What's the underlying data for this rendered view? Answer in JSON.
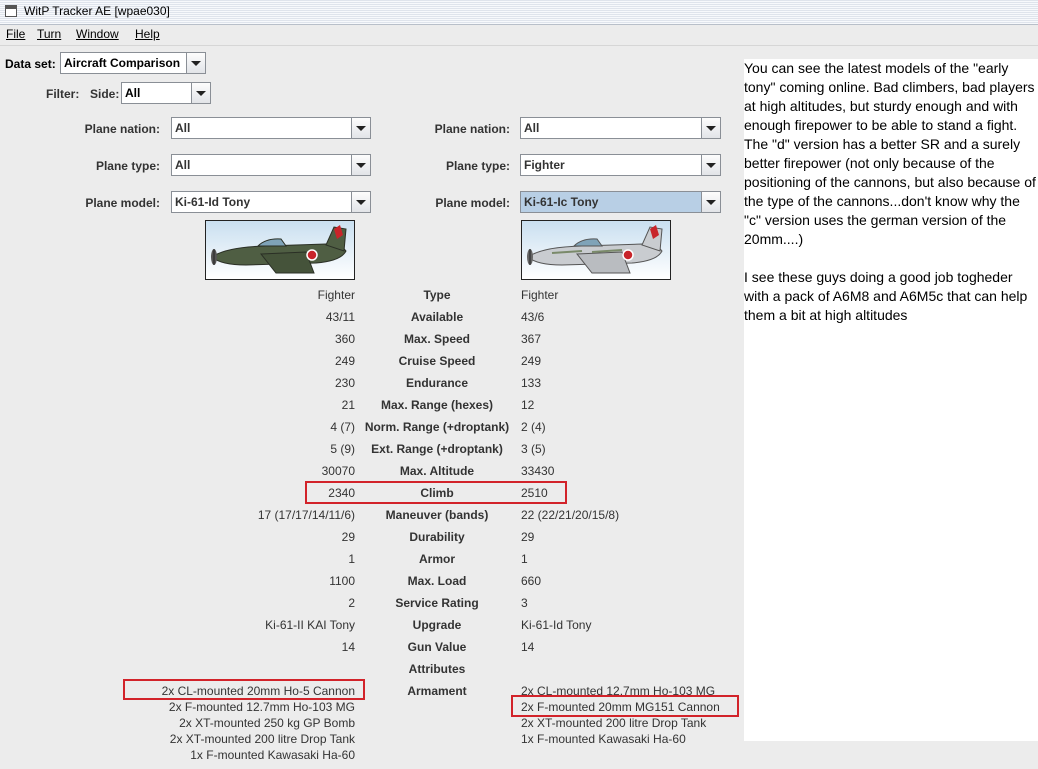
{
  "window": {
    "title": "WitP Tracker AE [wpae030]"
  },
  "menu": [
    "File",
    "Turn",
    "Window",
    "Help"
  ],
  "dataset": {
    "label": "Data set:",
    "value": "Aircraft Comparison"
  },
  "filter": {
    "label": "Filter:",
    "side_label": "Side:",
    "side_value": "All"
  },
  "left": {
    "nation_label": "Plane nation:",
    "nation": "All",
    "type_label": "Plane type:",
    "type": "All",
    "model_label": "Plane model:",
    "model": "Ki-61-Id Tony"
  },
  "right": {
    "nation_label": "Plane nation:",
    "nation": "All",
    "type_label": "Plane type:",
    "type": "Fighter",
    "model_label": "Plane model:",
    "model": "Ki-61-Ic Tony"
  },
  "stats": [
    {
      "label": "Type",
      "left": "Fighter",
      "right": "Fighter"
    },
    {
      "label": "Available",
      "left": "43/11",
      "right": "43/6"
    },
    {
      "label": "Max. Speed",
      "left": "360",
      "right": "367"
    },
    {
      "label": "Cruise Speed",
      "left": "249",
      "right": "249"
    },
    {
      "label": "Endurance",
      "left": "230",
      "right": "133"
    },
    {
      "label": "Max. Range (hexes)",
      "left": "21",
      "right": "12"
    },
    {
      "label": "Norm. Range (+droptank)",
      "left": "4 (7)",
      "right": "2 (4)"
    },
    {
      "label": "Ext. Range (+droptank)",
      "left": "5 (9)",
      "right": "3 (5)"
    },
    {
      "label": "Max. Altitude",
      "left": "30070",
      "right": "33430"
    },
    {
      "label": "Climb",
      "left": "2340",
      "right": "2510"
    },
    {
      "label": "Maneuver (bands)",
      "left": "17 (17/17/14/11/6)",
      "right": "22 (22/21/20/15/8)"
    },
    {
      "label": "Durability",
      "left": "29",
      "right": "29"
    },
    {
      "label": "Armor",
      "left": "1",
      "right": "1"
    },
    {
      "label": "Max. Load",
      "left": "1100",
      "right": "660"
    },
    {
      "label": "Service Rating",
      "left": "2",
      "right": "3"
    },
    {
      "label": "Upgrade",
      "left": "Ki-61-II KAI Tony",
      "right": "Ki-61-Id Tony"
    },
    {
      "label": "Gun Value",
      "left": "14",
      "right": "14"
    },
    {
      "label": "Attributes",
      "left": "",
      "right": ""
    }
  ],
  "armament": {
    "label": "Armament",
    "left": [
      "2x CL-mounted 20mm Ho-5 Cannon",
      "2x F-mounted 12.7mm Ho-103 MG",
      "2x XT-mounted 250 kg GP Bomb",
      "2x XT-mounted 200 litre Drop Tank",
      "1x F-mounted Kawasaki Ha-60"
    ],
    "right": [
      "2x CL-mounted 12.7mm Ho-103 MG",
      "2x F-mounted 20mm MG151 Cannon",
      "2x XT-mounted 200 litre Drop Tank",
      "1x F-mounted Kawasaki Ha-60"
    ]
  },
  "commentary": [
    "You can see the latest models of the \"early",
    "tony\" coming online. Bad climbers, bad players",
    "at high altitudes, but sturdy enough and with",
    "enough firepower to be able to stand a fight.",
    "The \"d\" version has a better SR and a surely",
    "better firepower (not only because of the",
    "positioning of the cannons, but also because of",
    "the type of the cannons...don't know why the",
    "\"c\" version uses the german version of the",
    "20mm....)",
    "",
    "I see these guys doing a good job togheder",
    "with a pack of A6M8 and A6M5c that can help",
    "them a bit at high altitudes"
  ],
  "colors": {
    "highlight": "#d2232a",
    "selection": "#b8cfe5"
  }
}
